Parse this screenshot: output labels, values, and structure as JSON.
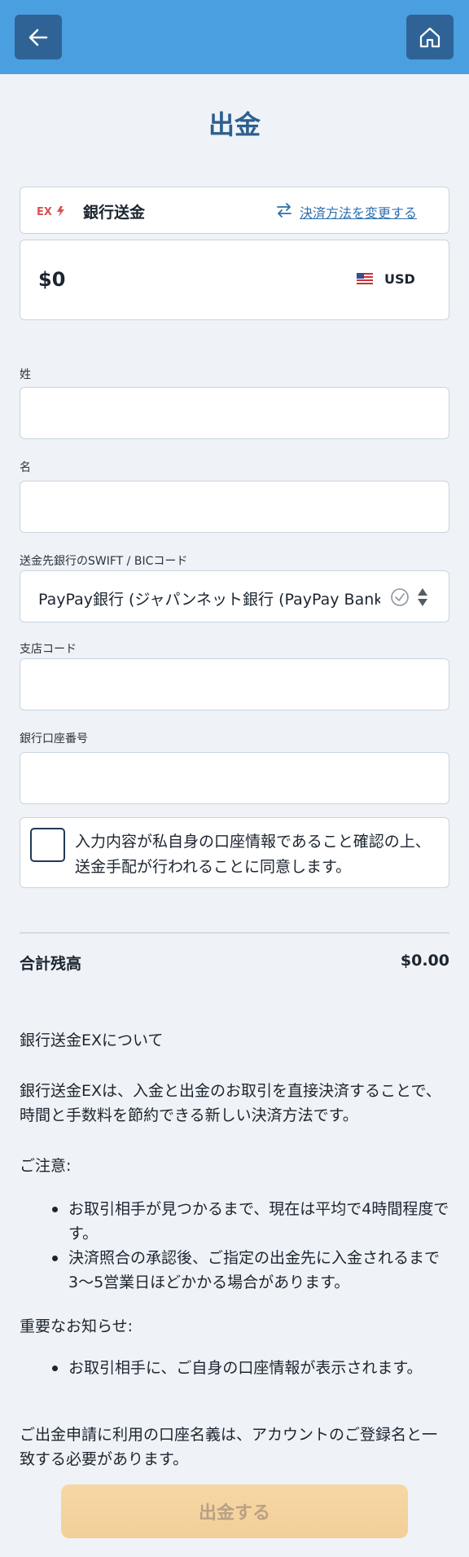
{
  "header": {
    "back_icon": "arrow-left-icon",
    "home_icon": "home-icon"
  },
  "page_title": "出金",
  "payment_method": {
    "logo_text": "EX",
    "name": "銀行送金",
    "change_label": "決済方法を変更する"
  },
  "amount": {
    "value": "$0",
    "currency": "USD"
  },
  "fields": {
    "last_name_label": "姓",
    "last_name_value": "",
    "first_name_label": "名",
    "first_name_value": "",
    "swift_label": "送金先銀行のSWIFT / BICコード",
    "swift_value": "PayPay銀行 (ジャパンネット銀行 (PayPay Bank",
    "branch_label": "支店コード",
    "branch_value": "",
    "account_label": "銀行口座番号",
    "account_value": ""
  },
  "agreement": {
    "text": "入力内容が私自身の口座情報であること確認の上、送金手配が行われることに同意します。",
    "checked": false
  },
  "total": {
    "label": "合計残高",
    "value": "$0.00"
  },
  "info": {
    "heading": "銀行送金EXについて",
    "description": "銀行送金EXは、入金と出金のお取引を直接決済することで、時間と手数料を節約できる新しい決済方法です。",
    "caution_heading": "ご注意:",
    "caution_items": [
      "お取引相手が見つかるまで、現在は平均で4時間程度です。",
      "決済照合の承認後、ご指定の出金先に入金されるまで3〜5営業日ほどかかる場合があります。"
    ],
    "notice_heading": "重要なお知らせ:",
    "notice_items": [
      "お取引相手に、ご自身の口座情報が表示されます。"
    ],
    "footer_note": "ご出金申請に利用の口座名義は、アカウントのご登録名と一致する必要があります。"
  },
  "submit_label": "出金する",
  "colors": {
    "header": "#4a9fe0",
    "header_button": "#2f6396",
    "title": "#2d5f8f",
    "link": "#2d6fae",
    "submit_disabled": "#f3cf99"
  }
}
